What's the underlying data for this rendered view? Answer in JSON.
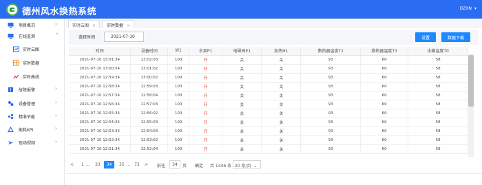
{
  "header": {
    "title": "德州风水换热系统",
    "user": "DZXN"
  },
  "colors": {
    "header": "#2a6cf2",
    "primary": "#1e88ff",
    "status_on": "#e0342a",
    "logo_ring": "#44b34a"
  },
  "sidebar": {
    "items": [
      {
        "label": "项目概况",
        "icon": "monitor-icon"
      },
      {
        "label": "在线监测",
        "icon": "monitor-icon"
      },
      {
        "label": "实时云图",
        "icon": "cloud-chart-icon"
      },
      {
        "label": "实时数据",
        "icon": "data-grid-icon"
      },
      {
        "label": "实时曲线",
        "icon": "curve-icon"
      },
      {
        "label": "故障报警",
        "icon": "alarm-icon"
      },
      {
        "label": "设备管理",
        "icon": "device-icon"
      },
      {
        "label": "精准节能",
        "icon": "energy-icon"
      },
      {
        "label": "能耗KPI",
        "icon": "kpi-icon"
      },
      {
        "label": "现场视频",
        "icon": "video-icon"
      }
    ]
  },
  "tabs": [
    {
      "label": "实时云图",
      "close": "×"
    },
    {
      "label": "实时数据",
      "close": "×"
    }
  ],
  "toolbar": {
    "date_label": "选择时间",
    "date_value": "2021-07-10",
    "settings_label": "设置",
    "download_label": "数据下载"
  },
  "table": {
    "columns": [
      "时间",
      "设备时间",
      "W1",
      "水泵P1",
      "电磁阀E1",
      "加热H1",
      "集热器温度T1",
      "换热器温度T3",
      "水箱温度T0"
    ],
    "rows": [
      [
        "2021-07-10 13:01:34",
        "13:02:03",
        "100",
        "开",
        "关",
        "关",
        "93",
        "60",
        "58"
      ],
      [
        "2021-07-10 13:00:54",
        "13:01:02",
        "100",
        "开",
        "关",
        "关",
        "93",
        "60",
        "58"
      ],
      [
        "2021-07-10 12:59:34",
        "13:00:02",
        "100",
        "开",
        "关",
        "关",
        "93",
        "60",
        "58"
      ],
      [
        "2021-07-10 12:58:34",
        "12:59:03",
        "100",
        "开",
        "关",
        "关",
        "93",
        "60",
        "58"
      ],
      [
        "2021-07-10 12:57:34",
        "12:58:04",
        "100",
        "开",
        "关",
        "关",
        "93",
        "60",
        "58"
      ],
      [
        "2021-07-10 12:56:34",
        "12:57:03",
        "100",
        "开",
        "关",
        "关",
        "93",
        "60",
        "58"
      ],
      [
        "2021-07-10 12:55:34",
        "12:56:02",
        "100",
        "开",
        "关",
        "关",
        "93",
        "60",
        "58"
      ],
      [
        "2021-07-10 12:54:34",
        "12:55:03",
        "100",
        "开",
        "关",
        "关",
        "93",
        "60",
        "58"
      ],
      [
        "2021-07-10 12:53:34",
        "12:54:03",
        "100",
        "开",
        "关",
        "关",
        "93",
        "60",
        "58"
      ],
      [
        "2021-07-10 12:52:34",
        "12:53:02",
        "100",
        "开",
        "关",
        "关",
        "93",
        "60",
        "58"
      ],
      [
        "2021-07-10 12:51:34",
        "12:52:04",
        "100",
        "开",
        "关",
        "关",
        "93",
        "60",
        "58"
      ]
    ]
  },
  "pager": {
    "prev": "<",
    "first": "1",
    "ellipsis": "...",
    "p33": "33",
    "current": "34",
    "p35": "35",
    "last": "73",
    "next": ">",
    "goto_label": "前往",
    "goto_value": "34",
    "page_unit": "页",
    "confirm": "确定",
    "total": "共 1446 条",
    "page_size": "20 条/页",
    "page_size_caret": "⌄"
  }
}
